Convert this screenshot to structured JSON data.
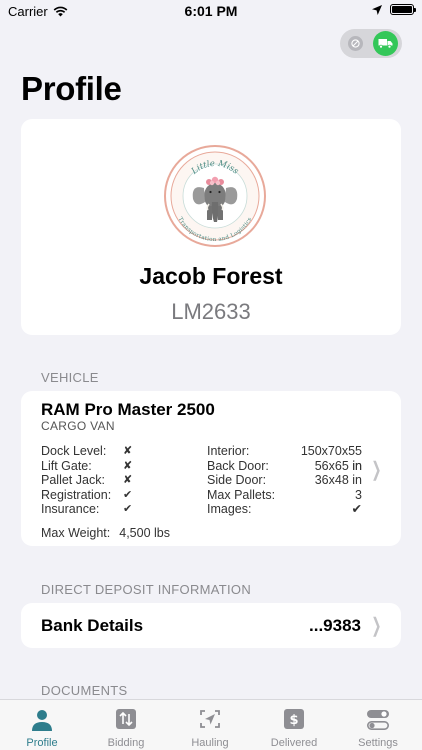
{
  "status_bar": {
    "carrier": "Carrier",
    "time": "6:01 PM"
  },
  "page_title": "Profile",
  "profile": {
    "logo_text_top": "Little Miss",
    "logo_text_bottom": "Transportation and Logistics",
    "name": "Jacob Forest",
    "id": "LM2633"
  },
  "vehicle_section": {
    "header": "VEHICLE",
    "name": "RAM Pro Master 2500",
    "type": "CARGO VAN",
    "left_specs": [
      {
        "label": "Dock Level:",
        "value": "✘"
      },
      {
        "label": "Lift Gate:",
        "value": "✘"
      },
      {
        "label": "Pallet Jack:",
        "value": "✘"
      },
      {
        "label": "Registration:",
        "value": "✔"
      },
      {
        "label": "Insurance:",
        "value": "✔"
      }
    ],
    "right_specs": [
      {
        "label": "Interior:",
        "value": "150x70x55 in"
      },
      {
        "label": "Back Door:",
        "value": "56x65 in"
      },
      {
        "label": "Side Door:",
        "value": "36x48 in"
      },
      {
        "label": "Max Pallets:",
        "value": "3"
      },
      {
        "label": "Images:",
        "value": "✔"
      }
    ],
    "max_weight_label": "Max Weight:",
    "max_weight_value": "4,500 lbs"
  },
  "deposit_section": {
    "header": "DIRECT DEPOSIT INFORMATION",
    "label": "Bank Details",
    "value": "...9383"
  },
  "documents_section": {
    "header": "DOCUMENTS"
  },
  "tabs": [
    {
      "label": "Profile",
      "icon": "person-icon",
      "active": true
    },
    {
      "label": "Bidding",
      "icon": "bidding-arrows-icon",
      "active": false
    },
    {
      "label": "Hauling",
      "icon": "hauling-navigation-icon",
      "active": false
    },
    {
      "label": "Delivered",
      "icon": "dollar-icon",
      "active": false
    },
    {
      "label": "Settings",
      "icon": "toggles-icon",
      "active": false
    }
  ],
  "colors": {
    "accent": "#2e7d8c",
    "toggle_on": "#34c759",
    "background": "#f2f2f7",
    "logo_ring": "#e8a99a"
  }
}
